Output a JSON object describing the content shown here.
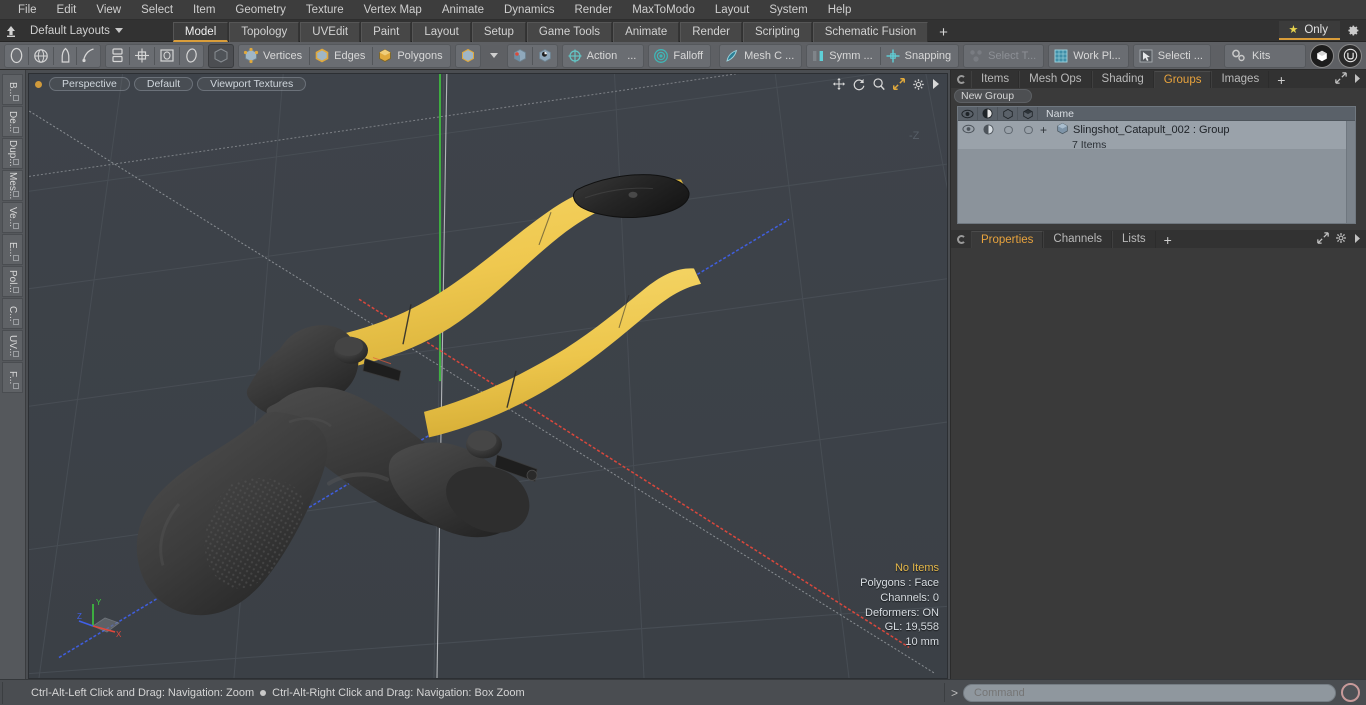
{
  "menubar": {
    "items": [
      "File",
      "Edit",
      "View",
      "Select",
      "Item",
      "Geometry",
      "Texture",
      "Vertex Map",
      "Animate",
      "Dynamics",
      "Render",
      "MaxToModo",
      "Layout",
      "System",
      "Help"
    ]
  },
  "layoutbar": {
    "home_icon": "home-arrow-icon",
    "layout_selector": "Default Layouts",
    "tabs": [
      {
        "label": "Model",
        "active": true
      },
      {
        "label": "Topology",
        "active": false
      },
      {
        "label": "UVEdit",
        "active": false
      },
      {
        "label": "Paint",
        "active": false
      },
      {
        "label": "Layout",
        "active": false
      },
      {
        "label": "Setup",
        "active": false
      },
      {
        "label": "Game Tools",
        "active": false
      },
      {
        "label": "Animate",
        "active": false
      },
      {
        "label": "Render",
        "active": false
      },
      {
        "label": "Scripting",
        "active": false
      },
      {
        "label": "Schematic Fusion",
        "active": false
      }
    ],
    "add_tab": "+",
    "only_button": "Only",
    "only_star_icon": "star-icon",
    "gear_icon": "gear-icon",
    "accent_color": "#d99d3a"
  },
  "toolbar": {
    "groups": [
      {
        "name": "primitives",
        "buttons": [
          {
            "label": "",
            "icon": "ellipse-icon"
          },
          {
            "label": "",
            "icon": "globe-icon"
          },
          {
            "label": "",
            "icon": "pen-icon"
          },
          {
            "label": "",
            "icon": "curve-icon"
          }
        ]
      },
      {
        "name": "transform",
        "buttons": [
          {
            "label": "",
            "icon": "stack-icon"
          },
          {
            "label": "",
            "icon": "center-icon"
          },
          {
            "label": "",
            "icon": "rect-icon"
          },
          {
            "label": "",
            "icon": "oval-icon"
          }
        ]
      },
      {
        "name": "selection-mode",
        "buttons": [
          {
            "label": "",
            "icon": "cube-dark-icon"
          },
          {
            "label": "Vertices",
            "icon": "vertices-icon"
          },
          {
            "label": "Edges",
            "icon": "edges-icon"
          },
          {
            "label": "Polygons",
            "icon": "polygons-icon"
          }
        ]
      },
      {
        "name": "item-mode",
        "buttons": [
          {
            "label": "",
            "icon": "cube-blue-icon"
          },
          {
            "label": "",
            "icon": "dropdown-arrow-icon"
          }
        ]
      },
      {
        "name": "center-pivot",
        "buttons": [
          {
            "label": "",
            "icon": "center-cube-icon"
          },
          {
            "label": "",
            "icon": "pivot-cube-icon"
          }
        ]
      },
      {
        "name": "action-center",
        "buttons": [
          {
            "label": "Action",
            "icon": "action-center-icon"
          },
          {
            "label": "...",
            "icon": ""
          }
        ]
      },
      {
        "name": "falloff",
        "buttons": [
          {
            "label": "Falloff",
            "icon": "falloff-icon"
          }
        ]
      },
      {
        "name": "mesh-constraint",
        "buttons": [
          {
            "label": "Mesh C ...",
            "icon": "mesh-constraint-icon"
          }
        ]
      },
      {
        "name": "symmetry",
        "buttons": [
          {
            "label": "Symm ...",
            "icon": "symmetry-icon"
          }
        ]
      },
      {
        "name": "snapping",
        "buttons": [
          {
            "label": "Snapping",
            "icon": "snapping-icon"
          }
        ]
      },
      {
        "name": "select-through",
        "buttons": [
          {
            "label": "Select T...",
            "icon": "select-through-icon",
            "disabled": true
          }
        ]
      },
      {
        "name": "work-plane",
        "buttons": [
          {
            "label": "Work Pl...",
            "icon": "work-plane-icon"
          }
        ]
      },
      {
        "name": "selection-sets",
        "buttons": [
          {
            "label": "Selecti ...",
            "icon": "selection-icon"
          }
        ]
      },
      {
        "name": "kits",
        "buttons": [
          {
            "label": "Kits",
            "icon": "kits-gear-icon"
          }
        ]
      }
    ],
    "right_icons": [
      "modo-badge-icon",
      "unreal-badge-icon"
    ]
  },
  "left_tabs": {
    "items": [
      "B...",
      "De...",
      "Dup...",
      "Mes...",
      "Ve...",
      "E...",
      "Pol...",
      "C...",
      "UV...",
      "F..."
    ]
  },
  "viewport": {
    "mode_dot": "viewport-active-dot",
    "perspective": "Perspective",
    "shading": "Default",
    "textures": "Viewport Textures",
    "tools": [
      "pan-icon",
      "rotate-icon",
      "zoom-icon",
      "fit-icon",
      "gear-icon",
      "arrow-icon"
    ],
    "axis_label_far": "-Z",
    "gizmo": {
      "x": "X",
      "y": "Y",
      "z": "Z"
    },
    "stats": {
      "items": "No Items",
      "polygons": "Polygons : Face",
      "channels": "Channels: 0",
      "deformers": "Deformers: ON",
      "gl": "GL: 19,558",
      "scale": "10 mm"
    },
    "background_color": "#3d4248",
    "model_body_color": "#343434",
    "model_band_color": "#e9c killed"
  },
  "right_panel": {
    "tabs": [
      {
        "label": "Items",
        "active": false
      },
      {
        "label": "Mesh Ops",
        "active": false
      },
      {
        "label": "Shading",
        "active": false
      },
      {
        "label": "Groups",
        "active": true
      },
      {
        "label": "Images",
        "active": false
      }
    ],
    "add_tab": "+",
    "new_group_button": "New Group",
    "tree": {
      "columns": [
        "visible-eye-icon",
        "shaded-icon",
        "wireframe-icon",
        "render-icon",
        "Name"
      ],
      "name_header": "Name",
      "rows": [
        {
          "expand": "+",
          "icon": "group-cube-icon",
          "title": "Slingshot_Catapult_002 : Group",
          "subtitle": "7 Items"
        }
      ]
    },
    "prop_tabs": [
      {
        "label": "Properties",
        "active": true
      },
      {
        "label": "Channels",
        "active": false
      },
      {
        "label": "Lists",
        "active": false
      }
    ],
    "prop_add_tab": "+",
    "prop_right_icons": [
      "expand-icon",
      "gear-icon",
      "arrow-icon"
    ]
  },
  "statusbar": {
    "message_left": "Ctrl-Alt-Left Click and Drag: Navigation: Zoom",
    "message_right": "Ctrl-Alt-Right Click and Drag: Navigation: Box Zoom",
    "command_prompt": ">",
    "command_placeholder": "Command",
    "command_value": "",
    "record_icon": "record-ring-icon"
  }
}
